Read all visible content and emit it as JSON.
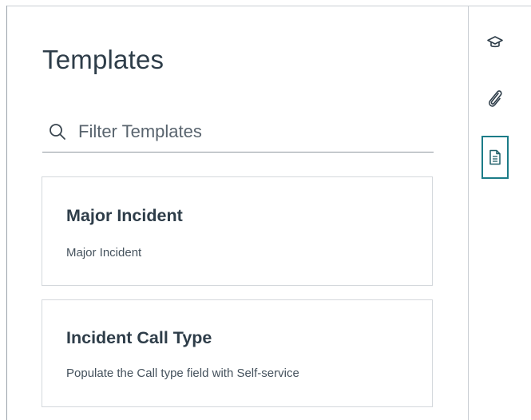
{
  "panel": {
    "title": "Templates",
    "filter": {
      "placeholder": "Filter Templates",
      "value": ""
    }
  },
  "templates": [
    {
      "title": "Major Incident",
      "description": "Major Incident"
    },
    {
      "title": "Incident Call Type",
      "description": "Populate the Call type field with Self-service"
    }
  ],
  "right_rail": {
    "items": [
      {
        "icon": "graduation-cap-icon",
        "active": false
      },
      {
        "icon": "paperclip-icon",
        "active": false
      },
      {
        "icon": "document-icon",
        "active": true
      }
    ]
  },
  "colors": {
    "text": "#2e3d49",
    "border": "#d4d8dc",
    "accent": "#1c7c88"
  }
}
